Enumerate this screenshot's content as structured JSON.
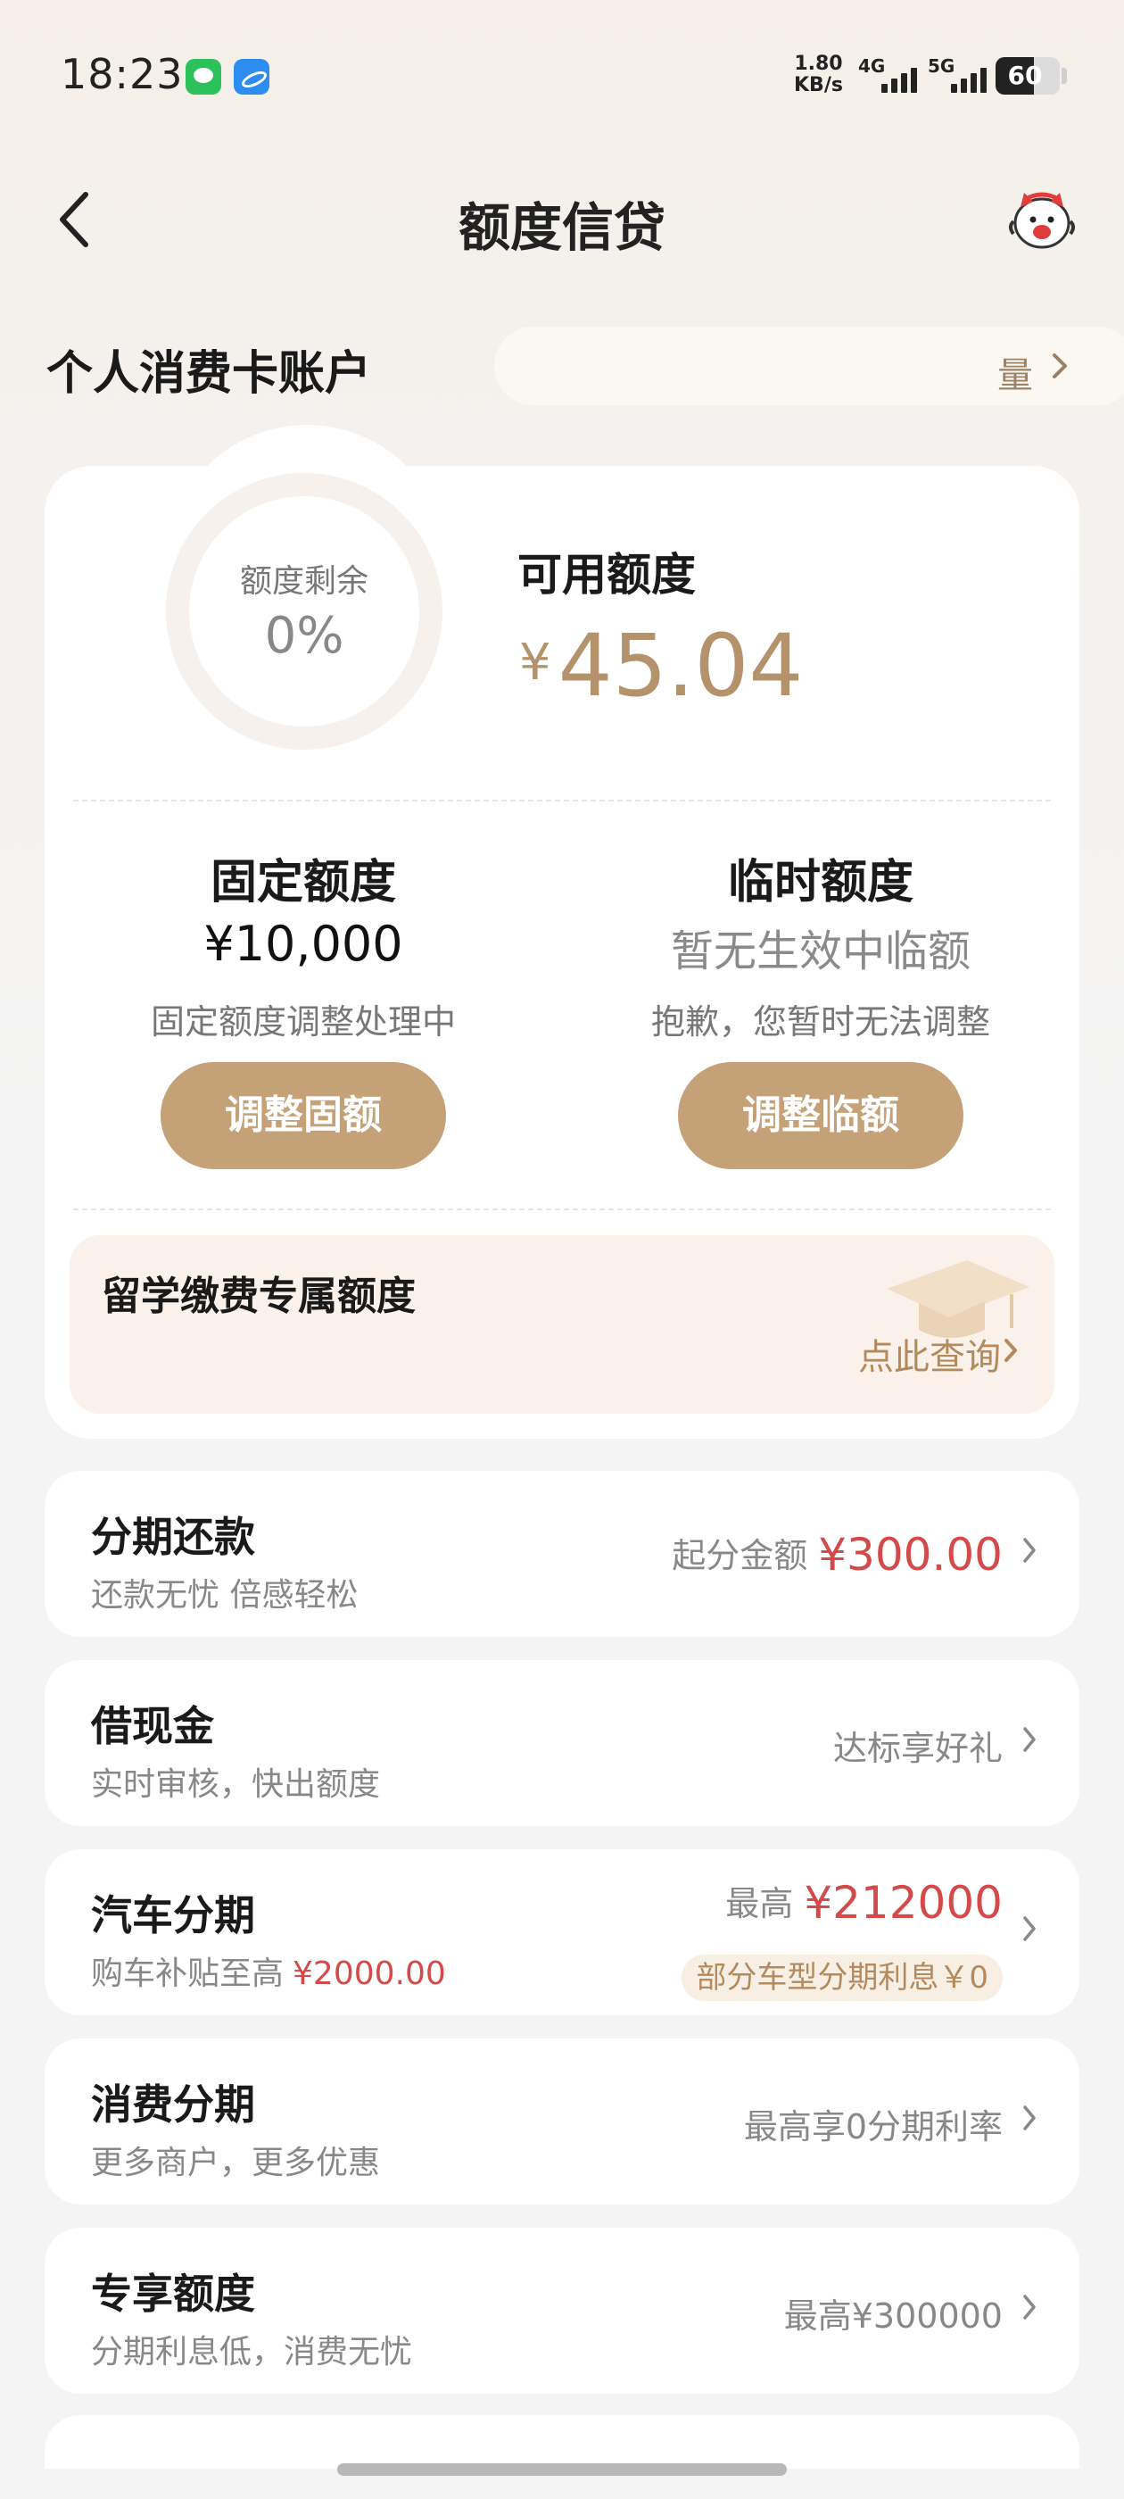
{
  "status_bar": {
    "time": "18:23",
    "app_icons": [
      "wechat-icon",
      "browser-icon"
    ],
    "net_speed_value": "1.80",
    "net_speed_unit": "KB/s",
    "signal_1": "4G",
    "signal_2": "5G",
    "battery": "60",
    "battery_level": 0.6
  },
  "nav": {
    "title": "额度信贷"
  },
  "account": {
    "title": "个人消费卡账户",
    "marquee_partial": "量"
  },
  "quota": {
    "ring_label": "额度剩余",
    "ring_value": "0%",
    "available_label": "可用额度",
    "currency": "¥",
    "available_amount": "45.04"
  },
  "fixed": {
    "title": "固定额度",
    "value": "¥10,000",
    "status": "固定额度调整处理中",
    "button": "调整固额"
  },
  "temp": {
    "title": "临时额度",
    "value": "暂无生效中临额",
    "status": "抱歉，您暂时无法调整",
    "button": "调整临额"
  },
  "study": {
    "title": "留学缴费专属额度",
    "link": "点此查询"
  },
  "list": [
    {
      "title": "分期还款",
      "subtitle": "还款无忧 倍感轻松",
      "right_label": "起分金额",
      "right_value": "¥300.00"
    },
    {
      "title": "借现金",
      "subtitle": "实时审核，快出额度",
      "right_label": "达标享好礼"
    },
    {
      "title": "汽车分期",
      "subtitle": "购车补贴至高",
      "subtitle_value": "¥2000.00",
      "right_label": "最高",
      "right_value": "¥212000",
      "badge": "部分车型分期利息￥0"
    },
    {
      "title": "消费分期",
      "subtitle": "更多商户，更多优惠",
      "right_label": "最高享0分期利率"
    },
    {
      "title": "专享额度",
      "subtitle": "分期利息低，消费无忧",
      "right_label": "最高¥300000"
    }
  ],
  "colors": {
    "accent_gold": "#c4a177",
    "amount_gold": "#b4936c",
    "red": "#d44a4a"
  }
}
